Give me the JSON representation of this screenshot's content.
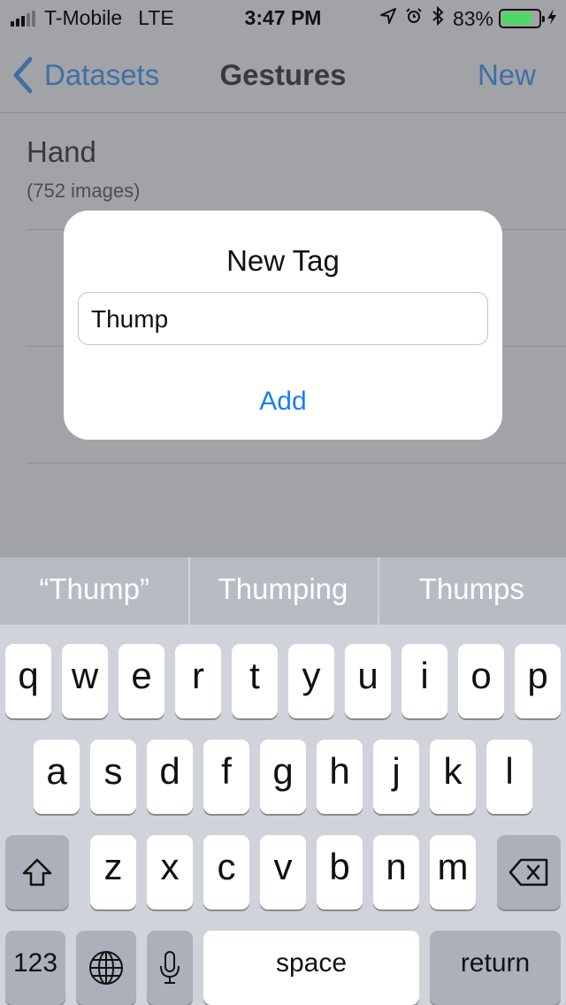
{
  "status_bar": {
    "carrier": "T-Mobile",
    "network": "LTE",
    "time": "3:47 PM",
    "battery_percent_text": "83%",
    "battery_level": 0.83,
    "icons": [
      "location-icon",
      "alarm-icon",
      "bluetooth-icon",
      "battery-icon",
      "charging-icon"
    ]
  },
  "nav": {
    "back_label": "Datasets",
    "title": "Gestures",
    "right_label": "New"
  },
  "list": {
    "items": [
      {
        "title": "Hand",
        "subtitle": "(752 images)"
      }
    ]
  },
  "alert": {
    "title": "New Tag",
    "field_value": "Thump",
    "action_label": "Add"
  },
  "suggestions": [
    "“Thump”",
    "Thumping",
    "Thumps"
  ],
  "keyboard": {
    "row1": [
      "q",
      "w",
      "e",
      "r",
      "t",
      "y",
      "u",
      "i",
      "o",
      "p"
    ],
    "row2": [
      "a",
      "s",
      "d",
      "f",
      "g",
      "h",
      "j",
      "k",
      "l"
    ],
    "row3": [
      "z",
      "x",
      "c",
      "v",
      "b",
      "n",
      "m"
    ],
    "numbers_label": "123",
    "space_label": "space",
    "return_label": "return"
  },
  "colors": {
    "accent": "#1a7df2",
    "battery_fill": "#4cd964",
    "dim_overlay": "#a2a3a7",
    "keyboard_bg": "#d0d3d9"
  }
}
